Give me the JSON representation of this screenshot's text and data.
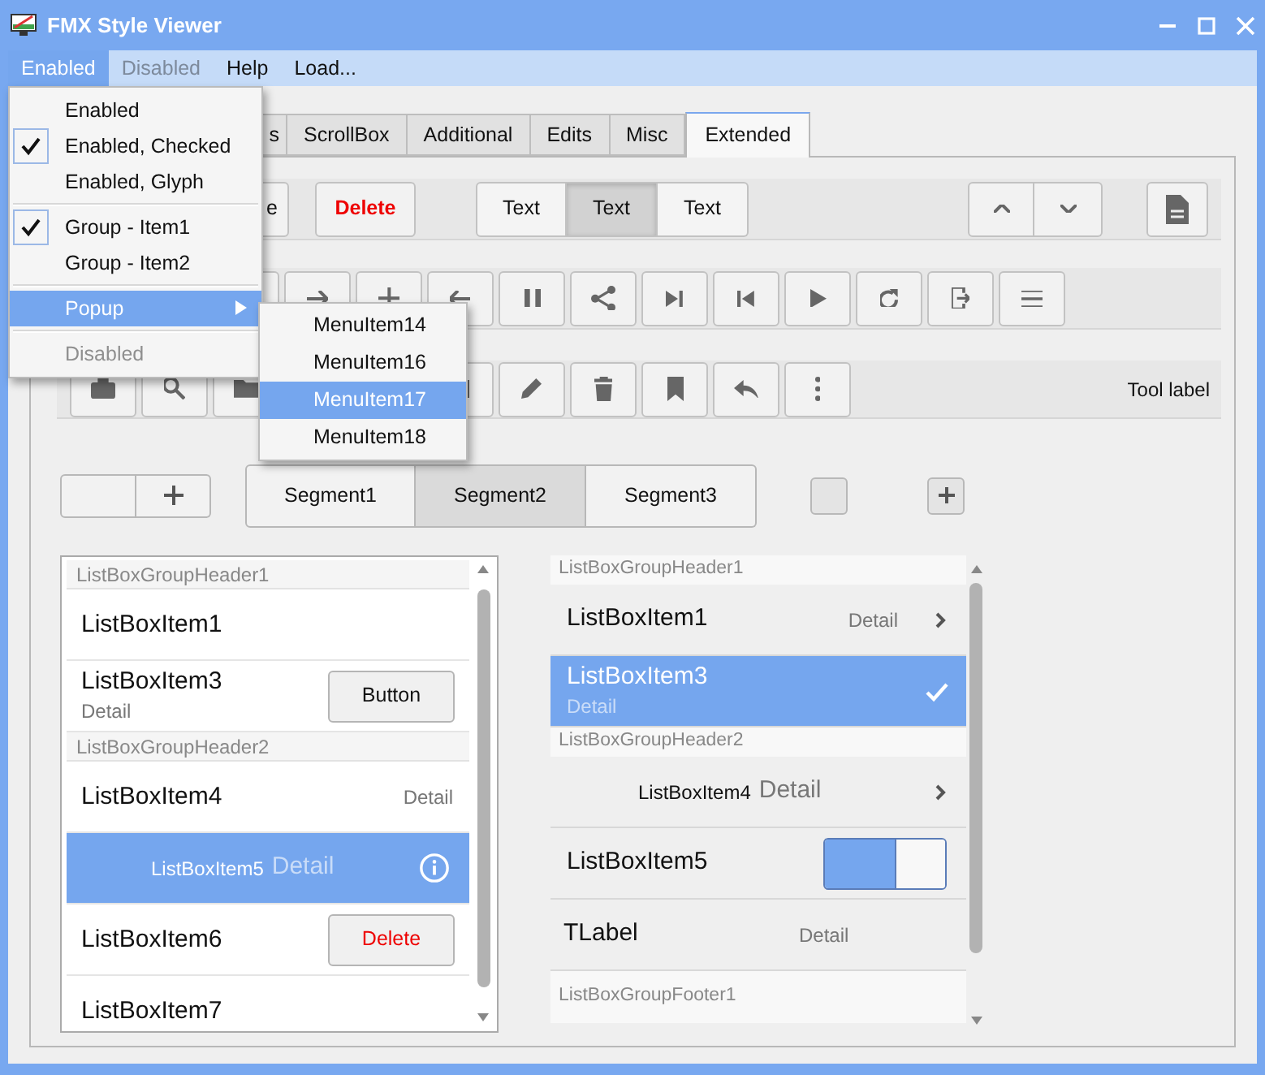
{
  "window": {
    "title": "FMX Style Viewer"
  },
  "menu_bar": [
    {
      "label": "Enabled",
      "selected": true,
      "disabled": false
    },
    {
      "label": "Disabled",
      "selected": false,
      "disabled": true
    },
    {
      "label": "Help",
      "selected": false,
      "disabled": false
    },
    {
      "label": "Load...",
      "selected": false,
      "disabled": false
    }
  ],
  "dropdown_menu": [
    {
      "kind": "item",
      "label": "Enabled",
      "checked": false,
      "selected": false,
      "disabled": false
    },
    {
      "kind": "item",
      "label": "Enabled, Checked",
      "checked": true,
      "selected": false,
      "disabled": false
    },
    {
      "kind": "item",
      "label": "Enabled, Glyph",
      "checked": false,
      "selected": false,
      "disabled": false
    },
    {
      "kind": "separator"
    },
    {
      "kind": "item",
      "label": "Group - Item1",
      "checked": true,
      "selected": false,
      "disabled": false
    },
    {
      "kind": "item",
      "label": "Group - Item2",
      "checked": false,
      "selected": false,
      "disabled": false
    },
    {
      "kind": "separator"
    },
    {
      "kind": "submenu",
      "label": "Popup",
      "checked": false,
      "selected": true,
      "disabled": false
    },
    {
      "kind": "separator"
    },
    {
      "kind": "item",
      "label": "Disabled",
      "checked": false,
      "selected": false,
      "disabled": true
    }
  ],
  "submenu": [
    {
      "label": "MenuItem14",
      "selected": false
    },
    {
      "label": "MenuItem16",
      "selected": false
    },
    {
      "label": "MenuItem17",
      "selected": true
    },
    {
      "label": "MenuItem18",
      "selected": false
    }
  ],
  "tabs": [
    {
      "label": "s",
      "selected": false
    },
    {
      "label": "ScrollBox",
      "selected": false
    },
    {
      "label": "Additional",
      "selected": false
    },
    {
      "label": "Edits",
      "selected": false
    },
    {
      "label": "Misc",
      "selected": false
    },
    {
      "label": "Extended",
      "selected": true
    }
  ],
  "toolbar_1": {
    "buttons": [
      {
        "kind": "plain",
        "label": "e"
      },
      {
        "kind": "danger",
        "label": "Delete"
      }
    ],
    "segments": [
      {
        "label": "Text",
        "selected": false
      },
      {
        "label": "Text",
        "selected": true
      },
      {
        "label": "Text",
        "selected": false
      }
    ]
  },
  "toolbar_3": {
    "label": "Tool label"
  },
  "segments": [
    {
      "label": "Segment1",
      "selected": false
    },
    {
      "label": "Segment2",
      "selected": true
    },
    {
      "label": "Segment3",
      "selected": false
    }
  ],
  "left_list": [
    {
      "kind": "header",
      "text": "ListBoxGroupHeader1"
    },
    {
      "kind": "plain",
      "text": "ListBoxItem1",
      "selected": false
    },
    {
      "kind": "button",
      "text": "ListBoxItem3",
      "detail": "Detail",
      "button": "Button",
      "danger": false,
      "selected": false
    },
    {
      "kind": "header",
      "text": "ListBoxGroupHeader2"
    },
    {
      "kind": "right_detail",
      "text": "ListBoxItem4",
      "detail": "Detail",
      "selected": false
    },
    {
      "kind": "info",
      "text": "ListBoxItem5",
      "detail": "Detail",
      "selected": true
    },
    {
      "kind": "button",
      "text": "ListBoxItem6",
      "button": "Delete",
      "danger": true,
      "selected": false
    },
    {
      "kind": "plain",
      "text": "ListBoxItem7",
      "selected": false
    }
  ],
  "right_list": [
    {
      "kind": "header",
      "text": "ListBoxGroupHeader1"
    },
    {
      "kind": "chevron",
      "text": "ListBoxItem1",
      "detail": "Detail",
      "selected": false
    },
    {
      "kind": "check",
      "text": "ListBoxItem3",
      "detail": "Detail",
      "selected": true
    },
    {
      "kind": "header",
      "text": "ListBoxGroupHeader2"
    },
    {
      "kind": "inline_chevron",
      "text": "ListBoxItem4",
      "detail": "Detail",
      "selected": false
    },
    {
      "kind": "switch",
      "text": "ListBoxItem5",
      "on": true,
      "selected": false
    },
    {
      "kind": "label",
      "text": "TLabel",
      "detail": "Detail",
      "selected": false
    },
    {
      "kind": "footer",
      "text": "ListBoxGroupFooter1"
    }
  ]
}
